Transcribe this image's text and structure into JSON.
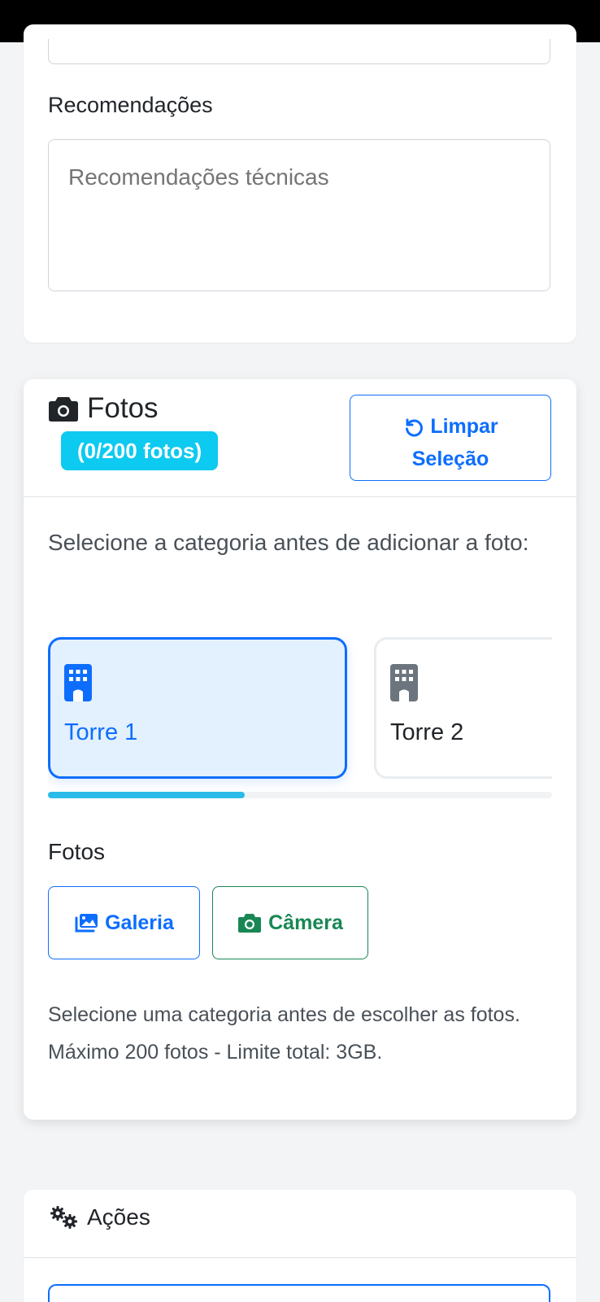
{
  "recommendations": {
    "label": "Recomendações",
    "placeholder": "Recomendações técnicas"
  },
  "photos": {
    "title": "Fotos",
    "count_badge": "(0/200 fotos)",
    "clear_button": {
      "line1": "Limpar",
      "line2": "Seleção"
    },
    "instruction": "Selecione a categoria antes de adicionar a foto:",
    "categories": [
      {
        "label": "Torre 1",
        "selected": true
      },
      {
        "label": "Torre 2",
        "selected": false
      }
    ],
    "upload_label": "Fotos",
    "gallery_button": "Galeria",
    "camera_button": "Câmera",
    "help_text": "Selecione uma categoria antes de escolher as fotos. Máximo 200 fotos - Limite total: 3GB."
  },
  "actions": {
    "title": "Ações"
  },
  "colors": {
    "primary": "#0d6efd",
    "info": "#0dcaf0",
    "success": "#198754",
    "selected_bg": "#e3f0fd"
  },
  "icons": {
    "photos_title": "camera-icon",
    "clear": "undo-icon",
    "category": "building-icon",
    "gallery": "images-icon",
    "camera": "camera-icon",
    "actions": "gears-icon"
  }
}
